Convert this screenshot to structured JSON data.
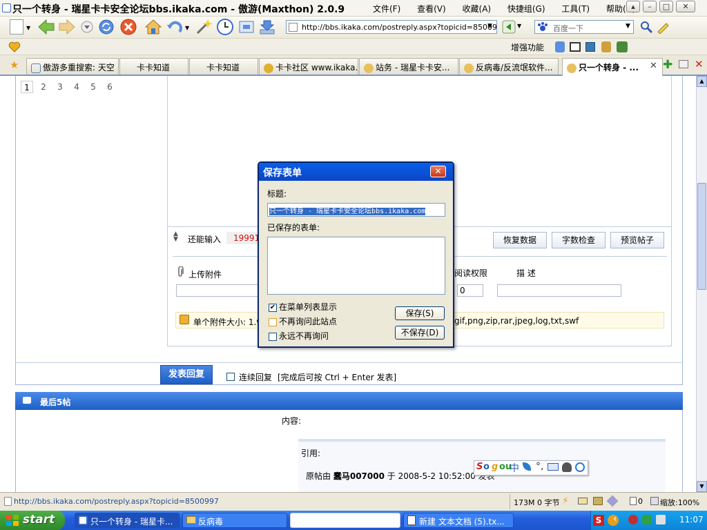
{
  "window": {
    "title": "只一个转身 - 瑞星卡卡安全论坛bbs.ikaka.com - 傲游(Maxthon) 2.0.9",
    "menu": [
      "文件(F)",
      "查看(V)",
      "收藏(A)",
      "快捷组(G)",
      "工具(T)",
      "帮助(H)"
    ]
  },
  "toolbar": {
    "address": "http://bbs.ikaka.com/postreply.aspx?topicid=8500997",
    "search_placeholder": "百度一下",
    "enhance_label": "增强功能"
  },
  "tabs": [
    {
      "label": "傲游多重搜索: 天空"
    },
    {
      "label": "卡卡知道"
    },
    {
      "label": "卡卡知道"
    },
    {
      "label": "卡卡社区 www.ikaka..."
    },
    {
      "label": "站务 - 瑞星卡卡安..."
    },
    {
      "label": "反病毒/反流氓软件..."
    },
    {
      "label": "只一个转身 - ..."
    }
  ],
  "page": {
    "pager": [
      "1",
      "2",
      "3",
      "4",
      "5",
      "6"
    ],
    "remaining_label": "还能输入",
    "remaining_count": "19991",
    "btn_restore": "恢复数据",
    "btn_count": "字数检查",
    "btn_preview": "预览帖子",
    "upload_label": "上传附件",
    "read_perm_label": "阅读权限",
    "read_perm_value": "0",
    "desc_label": "描 述",
    "size_note": "单个附件大小: 1.9",
    "types_note": "gif,png,zip,rar,jpeg,log,txt,swf",
    "submit_label": "发表回复",
    "continue_label": "连续回复",
    "continue_hint": "[完成后可按 Ctrl + Enter 发表]",
    "recent_header": "最后5帖",
    "content_label": "内容:",
    "quote_label": "引用:",
    "orig_prefix": "原帖由",
    "orig_author": "蠢马007000",
    "orig_mid": "于",
    "orig_time": "2008-5-2 10:52:00",
    "orig_suffix": "发表"
  },
  "dialog": {
    "title": "保存表单",
    "title_label": "标题:",
    "title_value": "只一个转身 - 瑞星卡卡安全论坛bbs.ikaka.com",
    "saved_label": "已保存的表单:",
    "cb_show": "在菜单列表显示",
    "cb_show_checked": true,
    "cb_noask_site": "不再询问此站点",
    "cb_noask_site_checked": false,
    "cb_never": "永远不再询问",
    "cb_never_checked": false,
    "save_btn": "保存(S)",
    "nosave_btn": "不保存(D)"
  },
  "ime": {
    "label": "中"
  },
  "statusbar": {
    "url": "http://bbs.ikaka.com/postreply.aspx?topicid=8500997",
    "memory": "173M 0 字节",
    "count": "0",
    "zoom": "缩放:100%"
  },
  "taskbar": {
    "start": "start",
    "items": [
      "只一个转身 - 瑞星卡...",
      "反病毒",
      "",
      "新建 文本文档 (5).tx..."
    ],
    "clock": "11:07"
  },
  "colors": {
    "accent": "#1e5fc8",
    "titlebar_blue": "#0a5ee8",
    "taskbar": "#245edc",
    "start": "#3a9a34",
    "counter_red": "#d01010"
  }
}
